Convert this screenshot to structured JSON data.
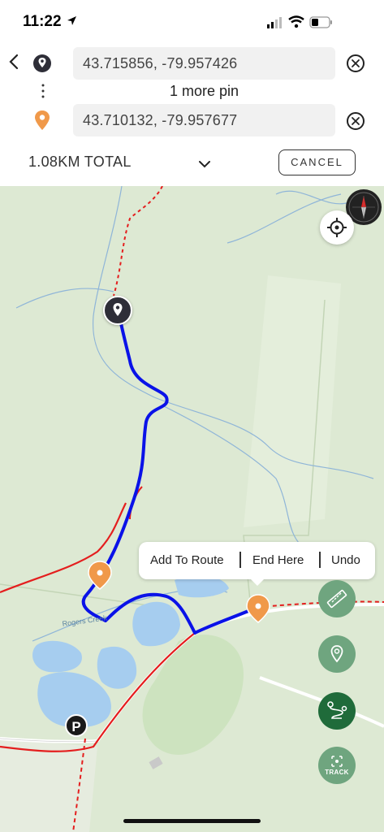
{
  "status_bar": {
    "time": "11:22"
  },
  "route_panel": {
    "start_coordinates": "43.715856,  -79.957426",
    "end_coordinates": "43.710132,  -79.957677",
    "more_pins_label": "1 more pin",
    "total_distance": "1.08KM TOTAL",
    "cancel_label": "CANCEL"
  },
  "map": {
    "popup": {
      "add_to_route": "Add To Route",
      "end_here": "End Here",
      "undo": "Undo"
    },
    "creek_label": "Rogers Creek",
    "parking_label": "P",
    "track_label": "TRACK"
  },
  "icons": {
    "back": "chevron-left-icon",
    "start_pin": "pin-icon",
    "end_pin": "orange-pin-icon",
    "clear": "close-circle-icon",
    "expand": "chevron-down-icon",
    "compass": "compass-icon",
    "locate": "crosshair-icon",
    "measure": "ruler-icon",
    "add_pin": "map-pin-icon",
    "route": "route-icon",
    "track": "track-icon"
  },
  "colors": {
    "route_line": "#0a12e8",
    "trail_red": "#e41e1e",
    "pin_orange": "#f0994a",
    "start_pin": "#2e2e38",
    "fab_green": "#6fa57f",
    "fab_dark_green": "#1f6b3a",
    "map_background": "#dde9d3",
    "water": "#a6cdef"
  }
}
